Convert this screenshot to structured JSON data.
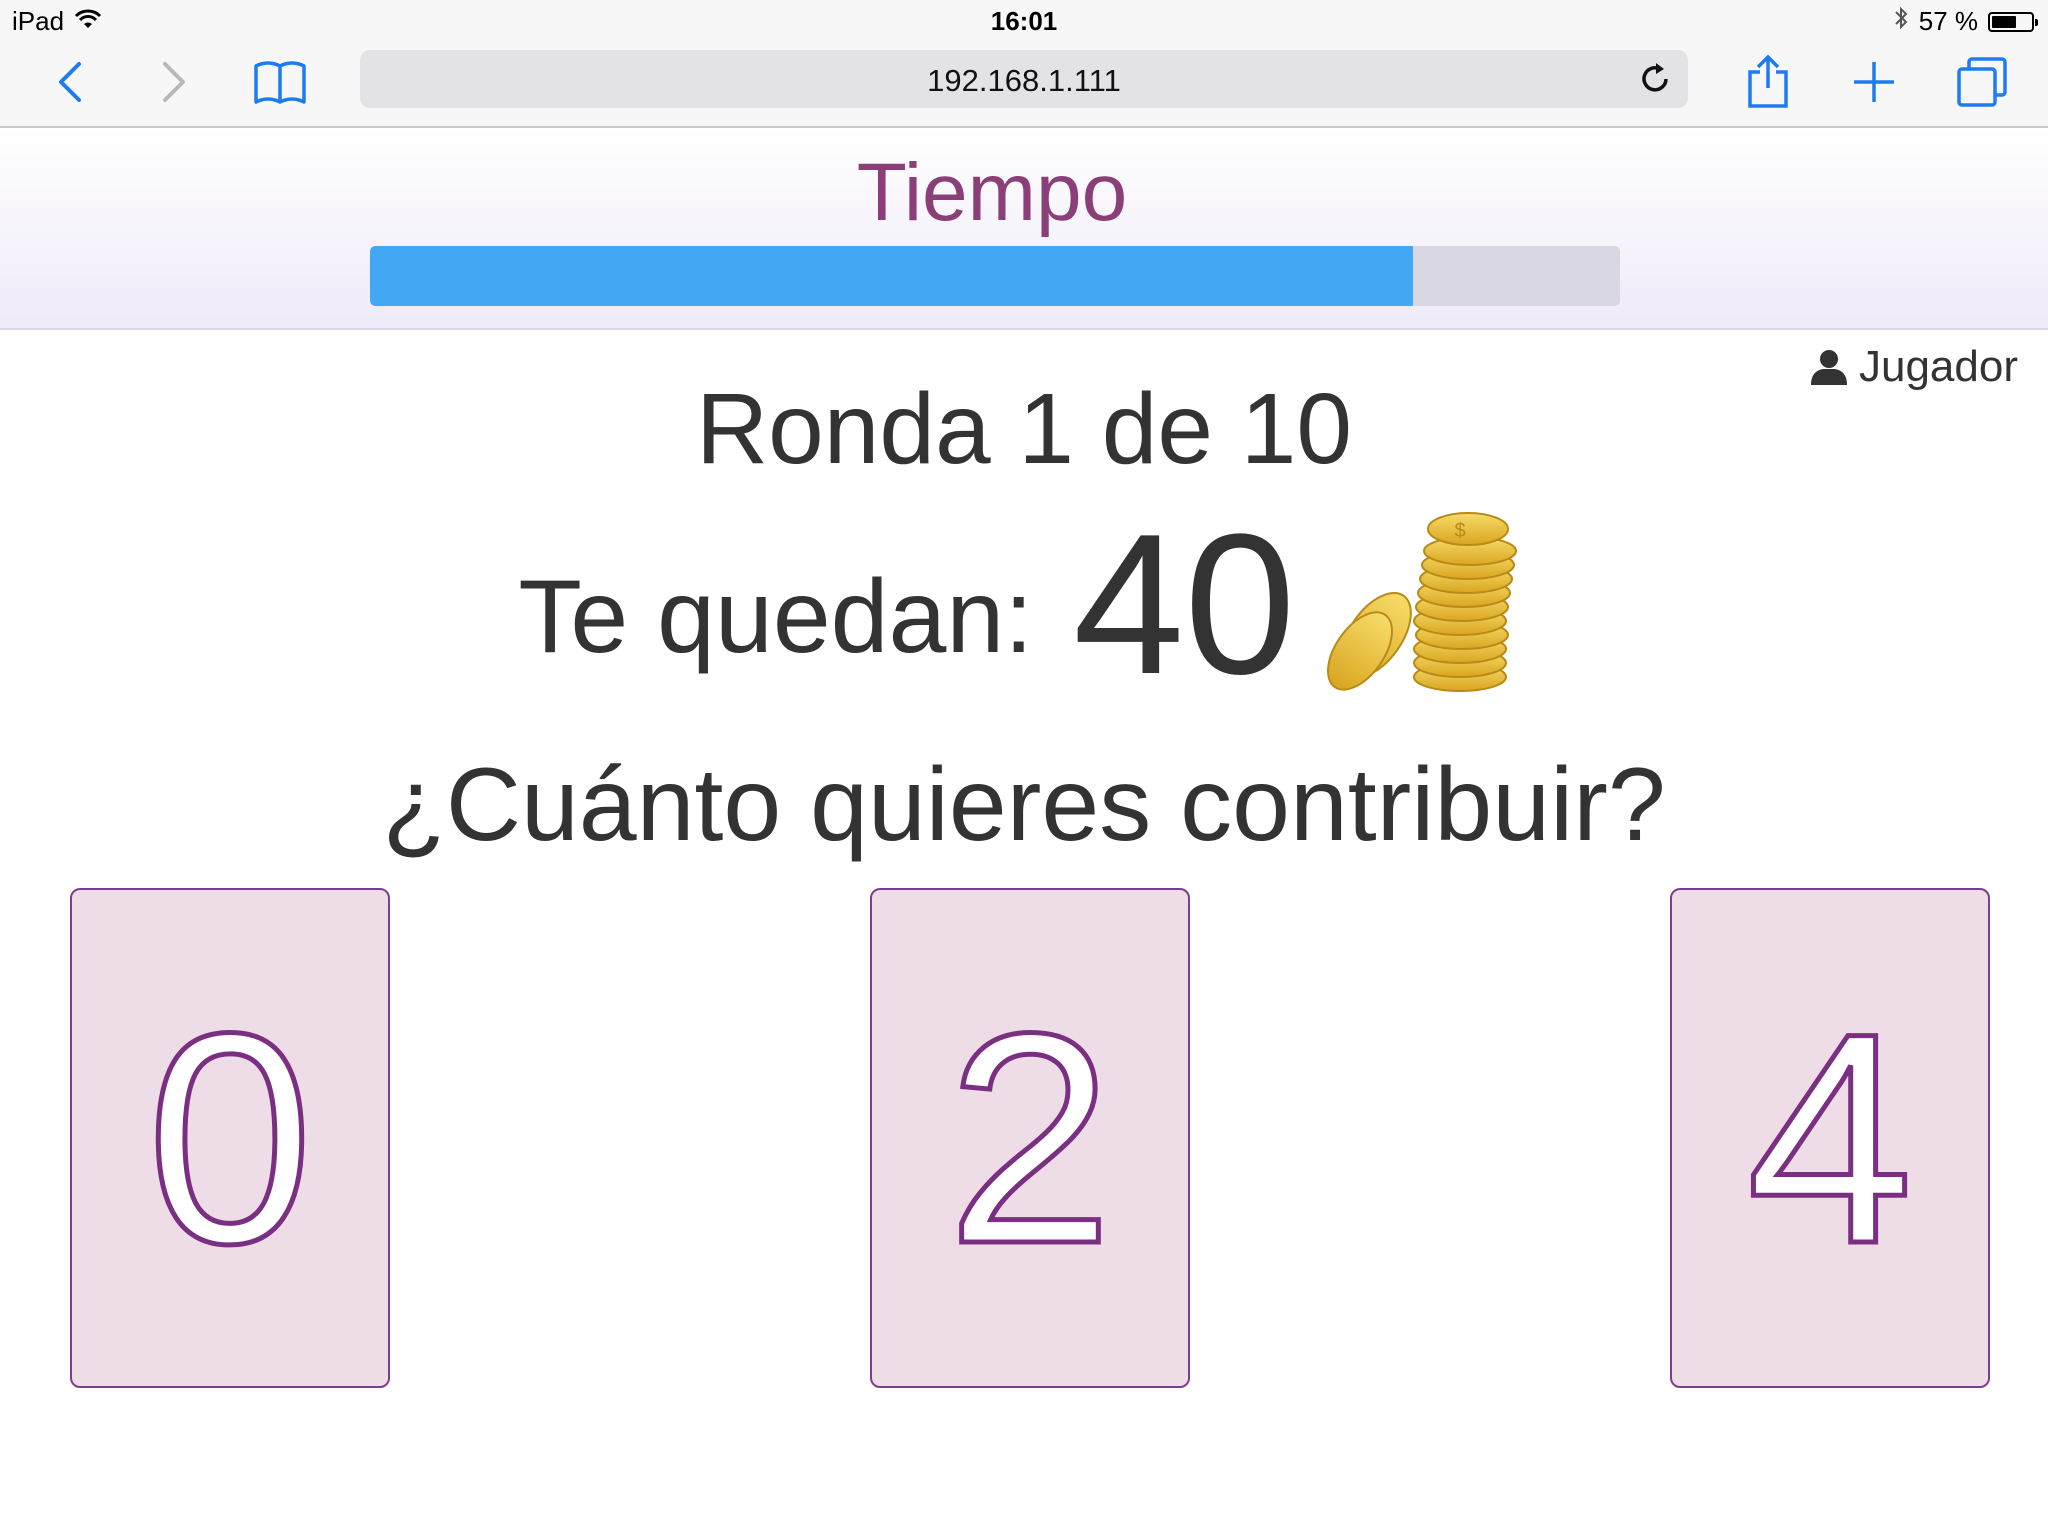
{
  "status_bar": {
    "device": "iPad",
    "time": "16:01",
    "battery": "57 %"
  },
  "browser": {
    "url": "192.168.1.111",
    "icons": [
      "back-icon",
      "forward-icon",
      "bookmarks-icon",
      "reload-icon",
      "share-icon",
      "new-tab-icon",
      "tabs-icon"
    ]
  },
  "timer": {
    "title": "Tiempo",
    "progress": 0.834
  },
  "player": {
    "label": "Jugador"
  },
  "game": {
    "round_text": "Ronda 1 de 10",
    "remaining_label": "Te quedan:",
    "remaining_amount": "40",
    "question": "¿Cuánto quieres contribuir?"
  },
  "options": [
    {
      "value": "0"
    },
    {
      "value": "2"
    },
    {
      "value": "4"
    }
  ],
  "colors": {
    "accent_purple": "#7b2f82",
    "title_purple": "#8b3f78",
    "progress_blue": "#42a8f4",
    "card_bg": "#eedce6",
    "ios_blue": "#1e7cf2"
  }
}
